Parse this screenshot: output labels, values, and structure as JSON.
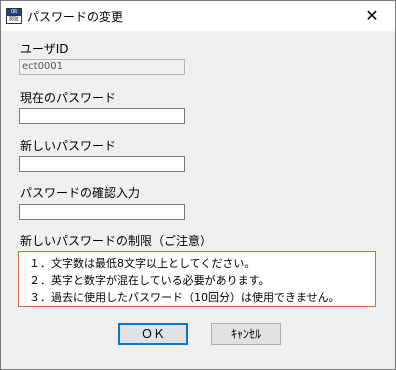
{
  "window": {
    "title": "パスワードの変更",
    "icon_text_top": "QR",
    "icon_text_bottom": "認証",
    "close_glyph": "✕"
  },
  "form": {
    "user_id_label": "ユーザID",
    "user_id_value": "ect0001",
    "current_password_label": "現在のパスワード",
    "current_password_value": "",
    "new_password_label": "新しいパスワード",
    "new_password_value": "",
    "confirm_password_label": "パスワードの確認入力",
    "confirm_password_value": ""
  },
  "rules": {
    "heading": "新しいパスワードの制限（ご注意）",
    "items": [
      "１．文字数は最低8文字以上としてください。",
      "２．英字と数字が混在している必要があります。",
      "３．過去に使用したパスワード（10回分）は使用できません。"
    ]
  },
  "buttons": {
    "ok_label": "ＯＫ",
    "cancel_label": "ｷｬﾝｾﾙ"
  }
}
